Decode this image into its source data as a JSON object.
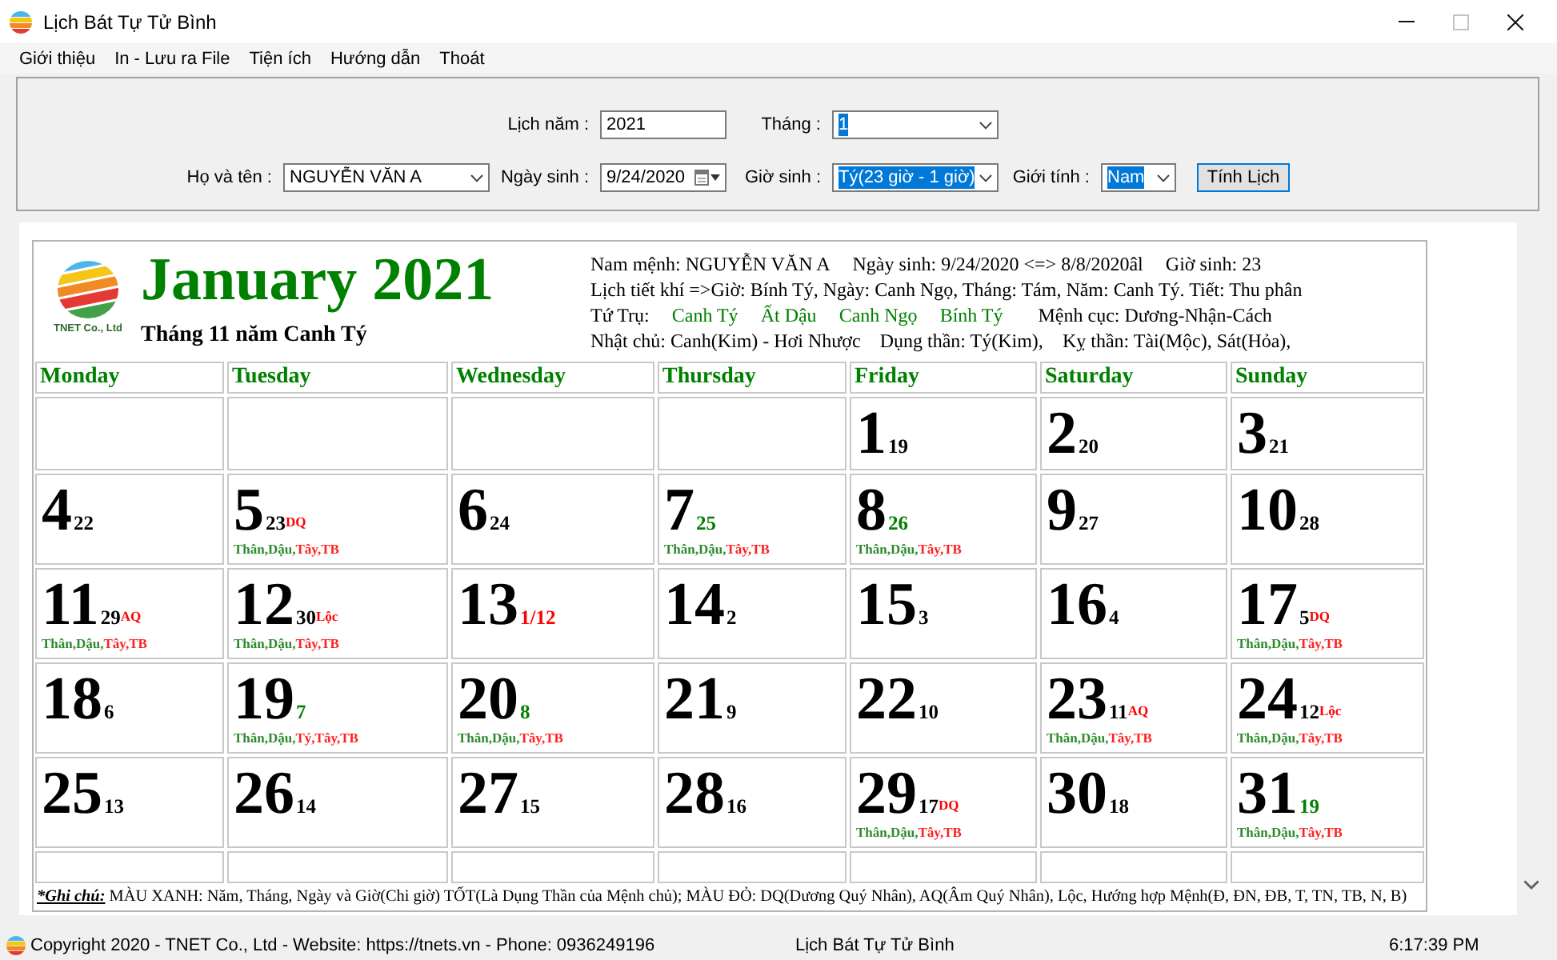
{
  "window": {
    "title": "Lịch Bát Tự Tử Bình",
    "controls": [
      {
        "kind": "minimize",
        "disabled": false
      },
      {
        "kind": "maximize",
        "disabled": true
      },
      {
        "kind": "close",
        "disabled": false
      }
    ]
  },
  "menu": [
    "Giới thiệu",
    "In - Lưu ra File",
    "Tiện ích",
    "Hướng dẫn",
    "Thoát"
  ],
  "form": {
    "year_fields": [
      {
        "label": "Lịch năm :",
        "kind": "text",
        "value": "2021",
        "highlighted": false
      },
      {
        "label": "Tháng :",
        "kind": "select",
        "value": "1",
        "highlighted": true
      }
    ],
    "person_fields": [
      {
        "label": "Họ và tên :",
        "kind": "select",
        "value": "NGUYỄN VĂN A",
        "highlighted": false
      },
      {
        "label": "Ngày sinh :",
        "kind": "date",
        "value": "9/24/2020",
        "highlighted": false
      },
      {
        "label": "Giờ sinh :",
        "kind": "select",
        "value": "Tý(23 giờ - 1 giờ)",
        "highlighted": true
      },
      {
        "label": "Giới tính :",
        "kind": "select",
        "value": "Nam",
        "highlighted": true
      }
    ],
    "button": "Tính Lịch"
  },
  "calendar": {
    "logo_caption": "TNET Co., Ltd",
    "title": "January 2021",
    "subtitle": "Tháng 11 năm Canh Tý",
    "info": {
      "owner": "Nam mệnh: NGUYỄN VĂN A",
      "birth_date": "Ngày sinh: 9/24/2020 <=> 8/8/2020âl",
      "birth_hour": "Giờ sinh: 23",
      "solar_terms": "Lịch tiết khí =>Giờ: Bính Tý, Ngày: Canh Ngọ, Tháng: Tám, Năm: Canh Tý. Tiết: Thu phân",
      "pillars_label": "Tứ Trụ:",
      "pillars": [
        "Canh Tý",
        "Ất Dậu",
        "Canh Ngọ",
        "Bính Tý"
      ],
      "destiny": "Mệnh cục: Dương-Nhận-Cách",
      "day_master": "Nhật chủ: Canh(Kim) - Hơi Nhược",
      "useful_god": "Dụng thần: Tý(Kim),",
      "taboo_god": "Kỵ thần: Tài(Mộc), Sát(Hỏa),"
    },
    "weekdays": [
      "Monday",
      "Tuesday",
      "Wednesday",
      "Thursday",
      "Friday",
      "Saturday",
      "Sunday"
    ],
    "weeks": [
      [
        {
          "day": "1",
          "lunar": {
            "text": "19",
            "color": "#000000"
          }
        },
        {
          "day": "2",
          "lunar": {
            "text": "20",
            "color": "#000000"
          }
        },
        {
          "day": "3",
          "lunar": {
            "text": "21",
            "color": "#000000"
          }
        }
      ],
      [
        {
          "day": "4",
          "lunar": {
            "text": "22",
            "color": "#000000"
          }
        },
        {
          "day": "5",
          "lunar": {
            "text": "23",
            "color": "#000000"
          },
          "tag": "DQ",
          "favorable": "Thân,Dậu,",
          "auspicious": "Tây,TB"
        },
        {
          "day": "6",
          "lunar": {
            "text": "24",
            "color": "#000000"
          }
        },
        {
          "day": "7",
          "lunar": {
            "text": "25",
            "color": "#008000"
          },
          "favorable": "Thân,Dậu,",
          "auspicious": "Tây,TB"
        },
        {
          "day": "8",
          "lunar": {
            "text": "26",
            "color": "#008000"
          },
          "favorable": "Thân,Dậu,",
          "auspicious": "Tây,TB"
        },
        {
          "day": "9",
          "lunar": {
            "text": "27",
            "color": "#000000"
          }
        },
        {
          "day": "10",
          "lunar": {
            "text": "28",
            "color": "#000000"
          }
        }
      ],
      [
        {
          "day": "11",
          "lunar": {
            "text": "29",
            "color": "#000000"
          },
          "tag": "AQ",
          "favorable": "Thân,Dậu,",
          "auspicious": "Tây,TB"
        },
        {
          "day": "12",
          "lunar": {
            "text": "30",
            "color": "#000000"
          },
          "tag": "Lộc",
          "favorable": "Thân,Dậu,",
          "auspicious": "Tây,TB"
        },
        {
          "day": "13",
          "lunar": {
            "text": "1/12",
            "color": "#ff0000"
          }
        },
        {
          "day": "14",
          "lunar": {
            "text": "2",
            "color": "#000000"
          }
        },
        {
          "day": "15",
          "lunar": {
            "text": "3",
            "color": "#000000"
          }
        },
        {
          "day": "16",
          "lunar": {
            "text": "4",
            "color": "#000000"
          }
        },
        {
          "day": "17",
          "lunar": {
            "text": "5",
            "color": "#000000"
          },
          "tag": "DQ",
          "favorable": "Thân,Dậu,",
          "auspicious": "Tây,TB"
        }
      ],
      [
        {
          "day": "18",
          "lunar": {
            "text": "6",
            "color": "#000000"
          }
        },
        {
          "day": "19",
          "lunar": {
            "text": "7",
            "color": "#008000"
          },
          "favorable": "Thân,Dậu,",
          "auspicious": "Tý,Tây,TB"
        },
        {
          "day": "20",
          "lunar": {
            "text": "8",
            "color": "#008000"
          },
          "favorable": "Thân,Dậu,",
          "auspicious": "Tây,TB"
        },
        {
          "day": "21",
          "lunar": {
            "text": "9",
            "color": "#000000"
          }
        },
        {
          "day": "22",
          "lunar": {
            "text": "10",
            "color": "#000000"
          }
        },
        {
          "day": "23",
          "lunar": {
            "text": "11",
            "color": "#000000"
          },
          "tag": "AQ",
          "favorable": "Thân,Dậu,",
          "auspicious": "Tây,TB"
        },
        {
          "day": "24",
          "lunar": {
            "text": "12",
            "color": "#000000"
          },
          "tag": "Lộc",
          "favorable": "Thân,Dậu,",
          "auspicious": "Tây,TB"
        }
      ],
      [
        {
          "day": "25",
          "lunar": {
            "text": "13",
            "color": "#000000"
          }
        },
        {
          "day": "26",
          "lunar": {
            "text": "14",
            "color": "#000000"
          }
        },
        {
          "day": "27",
          "lunar": {
            "text": "15",
            "color": "#000000"
          }
        },
        {
          "day": "28",
          "lunar": {
            "text": "16",
            "color": "#000000"
          }
        },
        {
          "day": "29",
          "lunar": {
            "text": "17",
            "color": "#000000"
          },
          "tag": "DQ",
          "favorable": "Thân,Dậu,",
          "auspicious": "Tây,TB"
        },
        {
          "day": "30",
          "lunar": {
            "text": "18",
            "color": "#000000"
          }
        },
        {
          "day": "31",
          "lunar": {
            "text": "19",
            "color": "#008000"
          },
          "favorable": "Thân,Dậu,",
          "auspicious": "Tây,TB"
        }
      ]
    ],
    "note": {
      "label": "*Ghi chú:",
      "text": "MÀU XANH: Năm, Tháng, Ngày và Giờ(Chi giờ) TỐT(Là Dụng Thần của Mệnh chủ); MÀU ĐỎ: DQ(Dương Quý Nhân), AQ(Âm Quý Nhân), Lộc, Hướng hợp Mệnh(Đ, ĐN, ĐB, T, TN, TB, N, B)"
    }
  },
  "status_bar": {
    "copyright": "Copyright 2020 - TNET Co., Ltd - Website: https://tnets.vn - Phone: 0936249196",
    "title": "Lịch Bát Tự Tử Bình",
    "time": "6:17:39 PM"
  }
}
